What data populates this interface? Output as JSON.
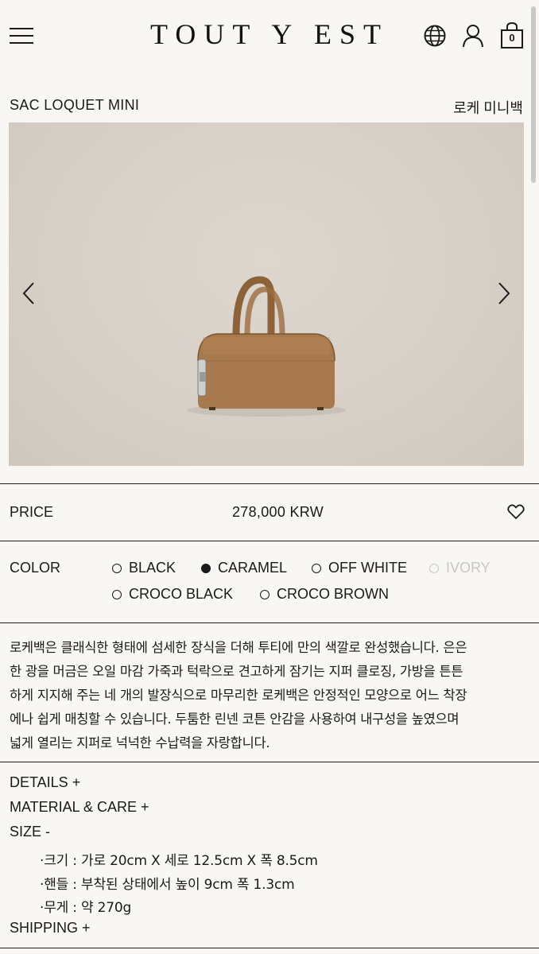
{
  "header": {
    "logo": "TOUT Y EST",
    "cart_count": "0",
    "icons": [
      "menu-icon",
      "globe-icon",
      "user-icon",
      "shopping-bag-icon"
    ]
  },
  "product": {
    "name_en": "SAC LOQUET MINI",
    "name_ko": "로케 미니백",
    "price_label": "PRICE",
    "price": "278,000 KRW",
    "color_label": "COLOR",
    "colors": [
      {
        "label": "BLACK",
        "selected": false,
        "available": true
      },
      {
        "label": "CARAMEL",
        "selected": true,
        "available": true
      },
      {
        "label": "OFF WHITE",
        "selected": false,
        "available": true
      },
      {
        "label": "IVORY",
        "selected": false,
        "available": false
      },
      {
        "label": "CROCO BLACK",
        "selected": false,
        "available": true
      },
      {
        "label": "CROCO BROWN",
        "selected": false,
        "available": true
      }
    ],
    "description": [
      "로케백은 클래식한 형태에 섬세한 장식을 더해 투티에 만의 색깔로 완성했습니다. 은은",
      "한 광을 머금은 오일 마감 가죽과 턱락으로 견고하게 잠기는 지퍼 클로징, 가방을 튼튼",
      "하게 지지해 주는 네 개의 발장식으로 마무리한 로케백은 안정적인 모양으로 어느 착장",
      "에나 쉽게 매칭할 수 있습니다. 두툼한 린넨 코튼 안감을 사용하여 내구성을 높였으며",
      "넓게 열리는 지퍼로 넉넉한 수납력을 자랑합니다."
    ]
  },
  "accordions": {
    "details": "DETAILS +",
    "material": "MATERIAL & CARE +",
    "size": "SIZE -",
    "size_specs": [
      "·크기 : 가로 20cm X 세로 12.5cm X 폭 8.5cm",
      "·핸들 : 부착된 상태에서 높이 9cm 폭 1.3cm",
      "·무게 : 약 270g"
    ],
    "shipping": "SHIPPING +"
  },
  "colors": {
    "background": "#f8f7f3",
    "text": "#1a1a1a",
    "disabled": "#c9c7c2",
    "bag_caramel": "#a7794d"
  }
}
